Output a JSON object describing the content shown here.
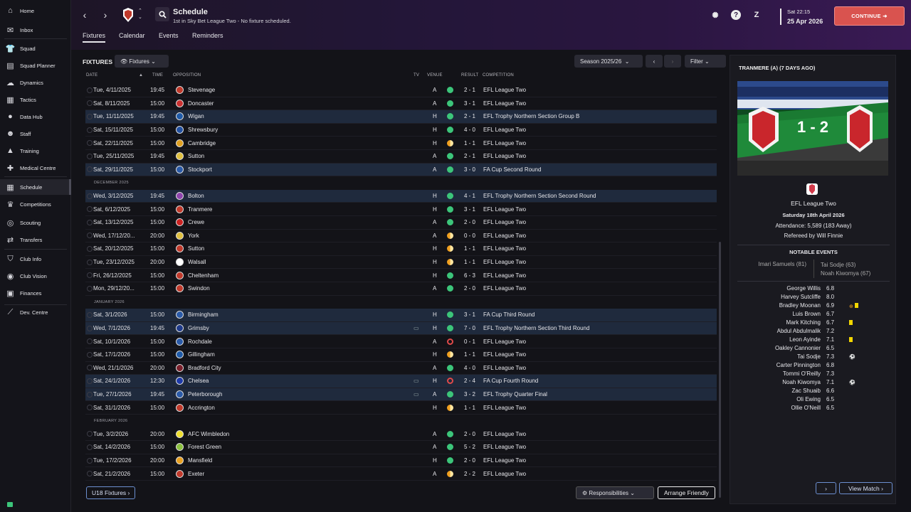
{
  "nav": [
    {
      "label": "Home",
      "icon": "home-icon"
    },
    {
      "label": "Inbox",
      "icon": "inbox-icon"
    },
    {
      "label": "Squad",
      "icon": "shirt-icon"
    },
    {
      "label": "Squad Planner",
      "icon": "planner-icon"
    },
    {
      "label": "Dynamics",
      "icon": "chat-icon"
    },
    {
      "label": "Tactics",
      "icon": "tactics-icon"
    },
    {
      "label": "Data Hub",
      "icon": "data-icon"
    },
    {
      "label": "Staff",
      "icon": "staff-icon"
    },
    {
      "label": "Training",
      "icon": "training-icon"
    },
    {
      "label": "Medical Centre",
      "icon": "medical-icon"
    },
    {
      "label": "Schedule",
      "icon": "calendar-icon"
    },
    {
      "label": "Competitions",
      "icon": "trophy-icon"
    },
    {
      "label": "Scouting",
      "icon": "scouting-icon"
    },
    {
      "label": "Transfers",
      "icon": "transfer-icon"
    },
    {
      "label": "Club Info",
      "icon": "shield-icon"
    },
    {
      "label": "Club Vision",
      "icon": "vision-icon"
    },
    {
      "label": "Finances",
      "icon": "finance-icon"
    },
    {
      "label": "Dev. Centre",
      "icon": "dev-icon"
    }
  ],
  "header": {
    "title": "Schedule",
    "subtitle": "1st in Sky Bet League Two - No fixture scheduled.",
    "tabs": [
      "Fixtures",
      "Calendar",
      "Events",
      "Reminders"
    ],
    "time": "Sat 22:15",
    "date": "25 Apr 2026",
    "continue": "CONTINUE"
  },
  "fixtures": {
    "heading": "FIXTURES",
    "view_dropdown": "Fixtures",
    "season": "Season 2025/26",
    "filter": "Filter",
    "columns": {
      "date": "DATE",
      "time": "TIME",
      "opp": "OPPOSITION",
      "tv": "TV",
      "venue": "VENUE",
      "result": "RESULT",
      "comp": "COMPETITION"
    },
    "rows": [
      {
        "date": "Tue, 4/11/2025",
        "time": "19:45",
        "opp": "Stevenage",
        "venue": "A",
        "outcome": "W",
        "result": "2 - 1",
        "comp": "EFL League Two",
        "tv": ""
      },
      {
        "date": "Sat, 8/11/2025",
        "time": "15:00",
        "opp": "Doncaster",
        "venue": "A",
        "outcome": "W",
        "result": "3 - 1",
        "comp": "EFL League Two",
        "tv": ""
      },
      {
        "date": "Tue, 11/11/2025",
        "time": "19:45",
        "opp": "Wigan",
        "venue": "H",
        "outcome": "W",
        "result": "2 - 1",
        "comp": "EFL Trophy Northern Section Group B",
        "tv": "",
        "hl": true
      },
      {
        "date": "Sat, 15/11/2025",
        "time": "15:00",
        "opp": "Shrewsbury",
        "venue": "H",
        "outcome": "W",
        "result": "4 - 0",
        "comp": "EFL League Two",
        "tv": ""
      },
      {
        "date": "Sat, 22/11/2025",
        "time": "15:00",
        "opp": "Cambridge",
        "venue": "H",
        "outcome": "D",
        "result": "1 - 1",
        "comp": "EFL League Two",
        "tv": ""
      },
      {
        "date": "Tue, 25/11/2025",
        "time": "19:45",
        "opp": "Sutton",
        "venue": "A",
        "outcome": "W",
        "result": "2 - 1",
        "comp": "EFL League Two",
        "tv": ""
      },
      {
        "date": "Sat, 29/11/2025",
        "time": "15:00",
        "opp": "Stockport",
        "venue": "A",
        "outcome": "W",
        "result": "3 - 0",
        "comp": "FA Cup Second Round",
        "tv": "",
        "hl": true
      },
      {
        "section": "DECEMBER 2025"
      },
      {
        "date": "Wed, 3/12/2025",
        "time": "19:45",
        "opp": "Bolton",
        "venue": "H",
        "outcome": "W",
        "result": "4 - 1",
        "comp": "EFL Trophy Northern Section Second Round",
        "tv": "",
        "hl": true
      },
      {
        "date": "Sat, 6/12/2025",
        "time": "15:00",
        "opp": "Tranmere",
        "venue": "H",
        "outcome": "W",
        "result": "3 - 1",
        "comp": "EFL League Two",
        "tv": ""
      },
      {
        "date": "Sat, 13/12/2025",
        "time": "15:00",
        "opp": "Crewe",
        "venue": "A",
        "outcome": "W",
        "result": "2 - 0",
        "comp": "EFL League Two",
        "tv": ""
      },
      {
        "date": "Wed, 17/12/20...",
        "time": "20:00",
        "opp": "York",
        "venue": "A",
        "outcome": "D",
        "result": "0 - 0",
        "comp": "EFL League Two",
        "tv": ""
      },
      {
        "date": "Sat, 20/12/2025",
        "time": "15:00",
        "opp": "Sutton",
        "venue": "H",
        "outcome": "D",
        "result": "1 - 1",
        "comp": "EFL League Two",
        "tv": ""
      },
      {
        "date": "Tue, 23/12/2025",
        "time": "20:00",
        "opp": "Walsall",
        "venue": "H",
        "outcome": "D",
        "result": "1 - 1",
        "comp": "EFL League Two",
        "tv": ""
      },
      {
        "date": "Fri, 26/12/2025",
        "time": "15:00",
        "opp": "Cheltenham",
        "venue": "H",
        "outcome": "W",
        "result": "6 - 3",
        "comp": "EFL League Two",
        "tv": ""
      },
      {
        "date": "Mon, 29/12/20...",
        "time": "15:00",
        "opp": "Swindon",
        "venue": "A",
        "outcome": "W",
        "result": "2 - 0",
        "comp": "EFL League Two",
        "tv": ""
      },
      {
        "section": "JANUARY 2026"
      },
      {
        "date": "Sat, 3/1/2026",
        "time": "15:00",
        "opp": "Birmingham",
        "venue": "H",
        "outcome": "W",
        "result": "3 - 1",
        "comp": "FA Cup Third Round",
        "tv": "",
        "hl": true
      },
      {
        "date": "Wed, 7/1/2026",
        "time": "19:45",
        "opp": "Grimsby",
        "venue": "H",
        "outcome": "W",
        "result": "7 - 0",
        "comp": "EFL Trophy Northern Section Third Round",
        "tv": "▭",
        "hl": true
      },
      {
        "date": "Sat, 10/1/2026",
        "time": "15:00",
        "opp": "Rochdale",
        "venue": "A",
        "outcome": "L",
        "result": "0 - 1",
        "comp": "EFL League Two",
        "tv": ""
      },
      {
        "date": "Sat, 17/1/2026",
        "time": "15:00",
        "opp": "Gillingham",
        "venue": "H",
        "outcome": "D",
        "result": "1 - 1",
        "comp": "EFL League Two",
        "tv": ""
      },
      {
        "date": "Wed, 21/1/2026",
        "time": "20:00",
        "opp": "Bradford City",
        "venue": "A",
        "outcome": "W",
        "result": "4 - 0",
        "comp": "EFL League Two",
        "tv": ""
      },
      {
        "date": "Sat, 24/1/2026",
        "time": "12:30",
        "opp": "Chelsea",
        "venue": "H",
        "outcome": "L",
        "result": "2 - 4",
        "comp": "FA Cup Fourth Round",
        "tv": "▭",
        "hl": true
      },
      {
        "date": "Tue, 27/1/2026",
        "time": "19:45",
        "opp": "Peterborough",
        "venue": "A",
        "outcome": "W",
        "result": "3 - 2",
        "comp": "EFL Trophy Quarter Final",
        "tv": "▭",
        "hl": true
      },
      {
        "date": "Sat, 31/1/2026",
        "time": "15:00",
        "opp": "Accrington",
        "venue": "H",
        "outcome": "D",
        "result": "1 - 1",
        "comp": "EFL League Two",
        "tv": ""
      },
      {
        "section": "FEBRUARY 2026"
      },
      {
        "date": "Tue, 3/2/2026",
        "time": "20:00",
        "opp": "AFC Wimbledon",
        "venue": "A",
        "outcome": "W",
        "result": "2 - 0",
        "comp": "EFL League Two",
        "tv": ""
      },
      {
        "date": "Sat, 14/2/2026",
        "time": "15:00",
        "opp": "Forest Green",
        "venue": "A",
        "outcome": "W",
        "result": "5 - 2",
        "comp": "EFL League Two",
        "tv": ""
      },
      {
        "date": "Tue, 17/2/2026",
        "time": "20:00",
        "opp": "Mansfield",
        "venue": "H",
        "outcome": "W",
        "result": "2 - 0",
        "comp": "EFL League Two",
        "tv": ""
      },
      {
        "date": "Sat, 21/2/2026",
        "time": "15:00",
        "opp": "Exeter",
        "venue": "A",
        "outcome": "D",
        "result": "2 - 2",
        "comp": "EFL League Two",
        "tv": ""
      }
    ],
    "u18": "U18 Fixtures",
    "responsibilities": "Responsibilities",
    "arrange": "Arrange Friendly"
  },
  "colors": {
    "W": "#3cc57a",
    "D": "#f0a020",
    "L": "#e04a4a"
  },
  "match": {
    "heading": "TRANMERE (A) (7 DAYS AGO)",
    "score": "1 - 2",
    "competition": "EFL League Two",
    "date": "Saturday 18th April 2026",
    "attendance": "Attendance: 5,589 (183 Away)",
    "referee": "Refereed by  Will Finnie",
    "events_heading": "NOTABLE EVENTS",
    "events_left": "Imari Samuels (81)",
    "events_right": [
      "Tai Sodje (63)",
      "Noah Kiwomya (67)"
    ],
    "ratings": [
      {
        "name": "George Willis",
        "r": "6.8",
        "icon": ""
      },
      {
        "name": "Harvey Sutcliffe",
        "r": "8.0",
        "icon": ""
      },
      {
        "name": "Bradley Moonan",
        "r": "6.9",
        "icon": "sub-yellow"
      },
      {
        "name": "Luis Brown",
        "r": "6.7",
        "icon": ""
      },
      {
        "name": "Mark Kitching",
        "r": "6.7",
        "icon": "yellow"
      },
      {
        "name": "Abdul Abdulmalik",
        "r": "7.2",
        "icon": ""
      },
      {
        "name": "Leon Ayinde",
        "r": "7.1",
        "icon": "yellow"
      },
      {
        "name": "Oakley Cannonier",
        "r": "6.5",
        "icon": ""
      },
      {
        "name": "Tai Sodje",
        "r": "7.3",
        "icon": "goal"
      },
      {
        "name": "Carter Pinnington",
        "r": "6.8",
        "icon": ""
      },
      {
        "name": "Tommi O'Reilly",
        "r": "7.3",
        "icon": ""
      },
      {
        "name": "Noah Kiwomya",
        "r": "7.1",
        "icon": "goal"
      },
      {
        "name": "Zac Shuaib",
        "r": "6.6",
        "icon": ""
      },
      {
        "name": "Oli Ewing",
        "r": "6.5",
        "icon": ""
      },
      {
        "name": "Ollie O'Neill",
        "r": "6.5",
        "icon": ""
      }
    ],
    "view_match": "View Match"
  }
}
